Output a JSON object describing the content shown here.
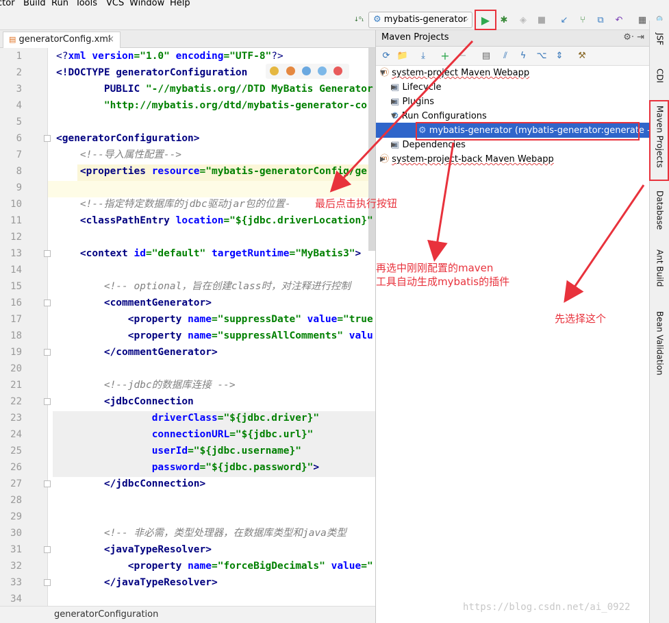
{
  "menu": [
    "ctor",
    "Build",
    "Run",
    "Tools",
    "VCS",
    "Window",
    "Help"
  ],
  "toolbar": {
    "run_config": "mybatis-generator"
  },
  "editor": {
    "tab_name": "generatorConfig.xml",
    "line_numbers": [
      "1",
      "2",
      "3",
      "4",
      "5",
      "6",
      "7",
      "8",
      "9",
      "10",
      "11",
      "12",
      "13",
      "14",
      "15",
      "16",
      "17",
      "18",
      "19",
      "20",
      "21",
      "22",
      "23",
      "24",
      "25",
      "26",
      "27",
      "28",
      "29",
      "30",
      "31",
      "32",
      "33",
      "34"
    ],
    "lines": {
      "l1a": "<?",
      "l1b": "xml version",
      "l1c": "=\"1.0\" ",
      "l1d": "encoding",
      "l1e": "=\"UTF-8\"",
      "l1f": "?>",
      "l2a": "<!DOCTYPE generatorConfiguration",
      "l3a": "        PUBLIC ",
      "l3b": "\"-//mybatis.org//DTD MyBatis Generator",
      "l4a": "        ",
      "l4b": "\"http://mybatis.org/dtd/mybatis-generator-co",
      "l6a": "<generatorConfiguration>",
      "l7a": "    <!--导入属性配置-->",
      "l8a": "    <properties ",
      "l8b": "resource",
      "l8c": "=\"mybatis-generatorConfig/ge",
      "l10a": "    <!--指定特定数据库的jdbc驱动jar包的位置-",
      "l11a": "    <classPathEntry ",
      "l11b": "location",
      "l11c": "=\"${jdbc.driverLocation}\"",
      "l13a": "    <context ",
      "l13b": "id",
      "l13c": "=\"default\" ",
      "l13d": "targetRuntime",
      "l13e": "=\"MyBatis3\"",
      "l13f": ">",
      "l15a": "        <!-- optional，旨在创建class时，对注释进行控制",
      "l16a": "        <commentGenerator>",
      "l17a": "            <property ",
      "l17b": "name",
      "l17c": "=\"suppressDate\" ",
      "l17d": "value",
      "l17e": "=\"true",
      "l18a": "            <property ",
      "l18b": "name",
      "l18c": "=\"suppressAllComments\" ",
      "l18d": "valu",
      "l19a": "        </commentGenerator>",
      "l21a": "        <!--jdbc的数据库连接 -->",
      "l22a": "        <jdbcConnection",
      "l23a": "                ",
      "l23b": "driverClass",
      "l23c": "=\"${jdbc.driver}\"",
      "l24a": "                ",
      "l24b": "connectionURL",
      "l24c": "=\"${jdbc.url}\"",
      "l25a": "                ",
      "l25b": "userId",
      "l25c": "=\"${jdbc.username}\"",
      "l26a": "                ",
      "l26b": "password",
      "l26c": "=\"${jdbc.password}\"",
      "l26d": ">",
      "l27a": "        </jdbcConnection>",
      "l30a": "        <!-- 非必需，类型处理器，在数据库类型和java类型",
      "l31a": "        <javaTypeResolver>",
      "l32a": "            <property ",
      "l32b": "name",
      "l32c": "=\"forceBigDecimals\" ",
      "l32d": "value",
      "l32e": "=\"",
      "l33a": "        </javaTypeResolver>"
    },
    "breadcrumb": "generatorConfiguration"
  },
  "maven": {
    "title": "Maven Projects",
    "tree": {
      "project1": "system-project Maven Webapp",
      "lifecycle": "Lifecycle",
      "plugins": "Plugins",
      "run_configs": "Run Configurations",
      "run_item": "mybatis-generator (mybatis-generator:generate -e)",
      "dependencies": "Dependencies",
      "project2": "system-project-back Maven Webapp"
    }
  },
  "right_strip": [
    "JSF",
    "CDI",
    "Maven Projects",
    "Database",
    "Ant Build",
    "Bean Validation"
  ],
  "annotations": {
    "note_run": "最后点击执行按钮",
    "note_select_line1": "再选中刚刚配置的maven",
    "note_select_line2": "工具自动生成mybatis的插件",
    "note_first": "先选择这个"
  },
  "watermark": "https://blog.csdn.net/ai_0922",
  "colors": {
    "annotation": "#e8323c",
    "selection": "#2f65ca",
    "tag": "#000080",
    "attr": "#0000ff",
    "value": "#008000",
    "comment": "#808080"
  }
}
